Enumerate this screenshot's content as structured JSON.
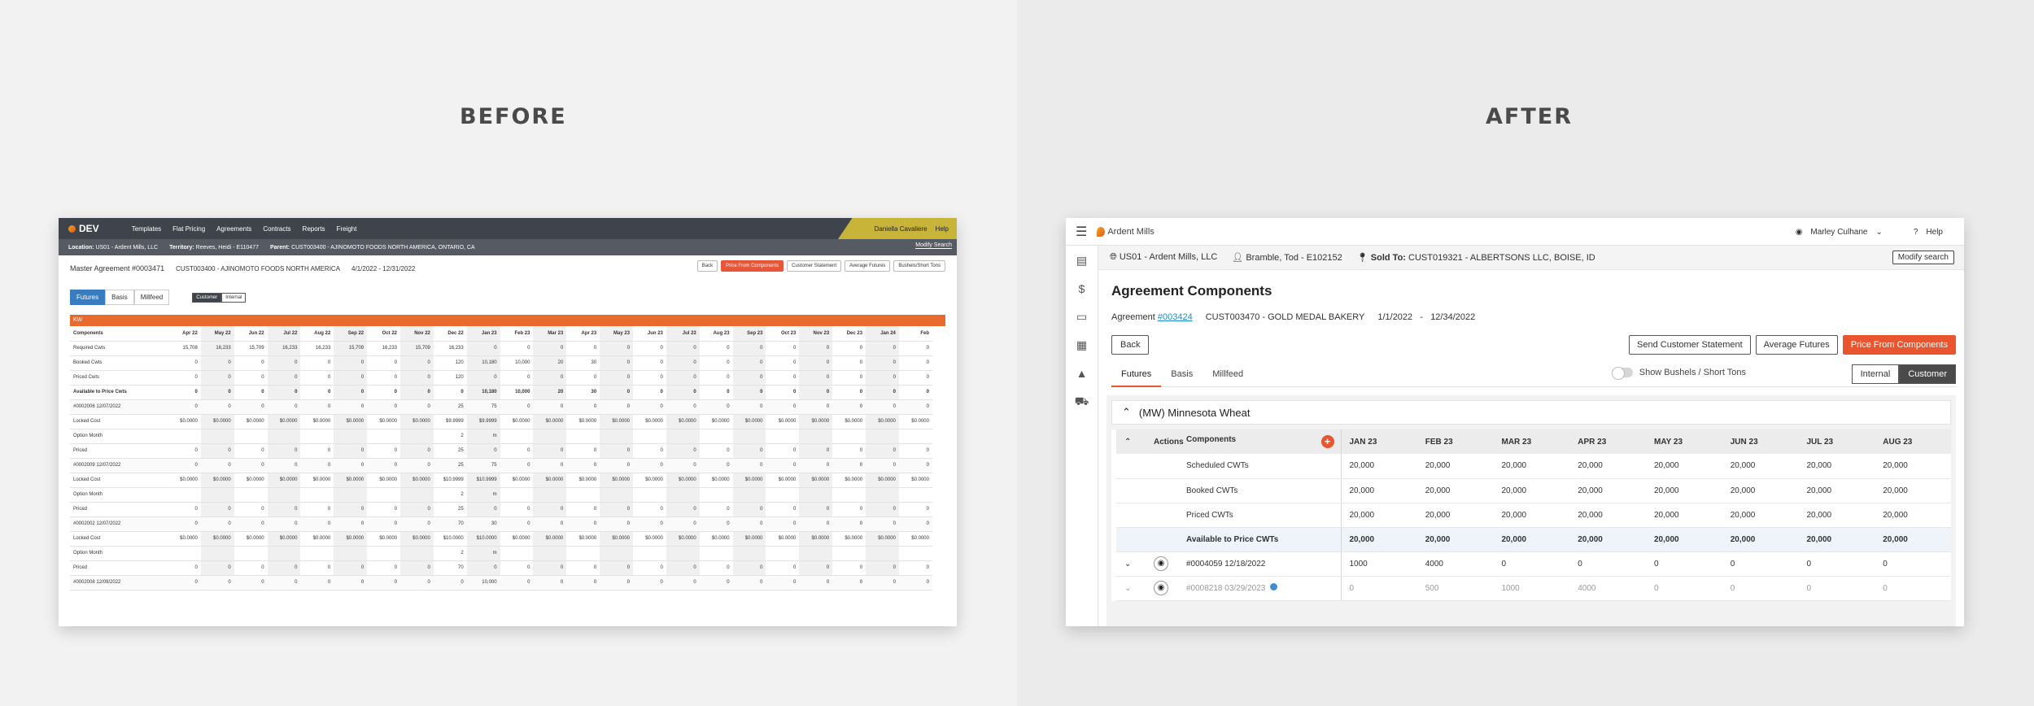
{
  "headings": {
    "before": "BEFORE",
    "after": "AFTER"
  },
  "before": {
    "logo": "DEV",
    "nav": [
      "Templates",
      "Flat Pricing",
      "Agreements",
      "Contracts",
      "Reports",
      "Freight"
    ],
    "user": "Daniella Cavaliere",
    "help": "Help",
    "location_label": "Location:",
    "location": "US01 - Ardent Mills, LLC",
    "territory_label": "Territory:",
    "territory": "Reeves, Heidi - E110477",
    "parent_label": "Parent:",
    "parent": "CUST003400 - AJINOMOTO FOODS NORTH AMERICA, ONTARIO, CA",
    "modify_search": "Modify Search",
    "title": "Master Agreement #0003471",
    "customer": "CUST003400 - AJINOMOTO FOODS NORTH AMERICA",
    "dates": "4/1/2022 - 12/31/2022",
    "buttons": [
      "Back",
      "Price From Components",
      "Customer Statement",
      "Average Futures",
      "Bushels/Short Tons"
    ],
    "tabs": [
      "Futures",
      "Basis",
      "Millfeed"
    ],
    "view_toggle": [
      "Customer",
      "Internal"
    ],
    "section": "KW",
    "components_label": "Components",
    "months": [
      "Apr 22",
      "May 22",
      "Jun 22",
      "Jul 22",
      "Aug 22",
      "Sep 22",
      "Oct 22",
      "Nov 22",
      "Dec 22",
      "Jan 23",
      "Feb 23",
      "Mar 23",
      "Apr 23",
      "May 23",
      "Jun 23",
      "Jul 23",
      "Aug 23",
      "Sep 23",
      "Oct 23",
      "Nov 23",
      "Dec 23",
      "Jan 24",
      "Feb"
    ],
    "rows": [
      {
        "label": "Required Cwts",
        "values": [
          "15,708",
          "16,233",
          "15,709",
          "16,233",
          "16,233",
          "15,709",
          "16,233",
          "15,709",
          "16,233",
          "0",
          "0",
          "0",
          "0",
          "0",
          "0",
          "0",
          "0",
          "0",
          "0",
          "0",
          "0",
          "0",
          "0"
        ]
      },
      {
        "label": "Booked Cwts",
        "values": [
          "0",
          "0",
          "0",
          "0",
          "0",
          "0",
          "0",
          "0",
          "120",
          "10,180",
          "10,000",
          "20",
          "30",
          "0",
          "0",
          "0",
          "0",
          "0",
          "0",
          "0",
          "0",
          "0",
          "0"
        ]
      },
      {
        "label": "Priced Cwts",
        "values": [
          "0",
          "0",
          "0",
          "0",
          "0",
          "0",
          "0",
          "0",
          "120",
          "0",
          "0",
          "0",
          "0",
          "0",
          "0",
          "0",
          "0",
          "0",
          "0",
          "0",
          "0",
          "0",
          "0"
        ]
      },
      {
        "label": "Available to Price Cwts",
        "bold": true,
        "values": [
          "0",
          "0",
          "0",
          "0",
          "0",
          "0",
          "0",
          "0",
          "0",
          "10,180",
          "10,000",
          "20",
          "30",
          "0",
          "0",
          "0",
          "0",
          "0",
          "0",
          "0",
          "0",
          "0",
          "0"
        ]
      },
      {
        "label": "#0002006 12/07/2022",
        "group": true,
        "values": [
          "0",
          "0",
          "0",
          "0",
          "0",
          "0",
          "0",
          "0",
          "25",
          "75",
          "0",
          "0",
          "0",
          "0",
          "0",
          "0",
          "0",
          "0",
          "0",
          "0",
          "0",
          "0",
          "0"
        ]
      },
      {
        "label": "Locked Cost",
        "values": [
          "$0.0000",
          "$0.0000",
          "$0.0000",
          "$0.0000",
          "$0.0000",
          "$0.0000",
          "$0.0000",
          "$0.0000",
          "$9.9999",
          "$9.9999",
          "$0.0000",
          "$0.0000",
          "$0.0000",
          "$0.0000",
          "$0.0000",
          "$0.0000",
          "$0.0000",
          "$0.0000",
          "$0.0000",
          "$0.0000",
          "$0.0000",
          "$0.0000",
          "$0.0000"
        ]
      },
      {
        "label": "Option Month",
        "values": [
          "",
          "",
          "",
          "",
          "",
          "",
          "",
          "",
          "2",
          "m",
          "",
          "",
          "",
          "",
          "",
          "",
          "",
          "",
          "",
          "",
          "",
          "",
          ""
        ]
      },
      {
        "label": "Priced",
        "values": [
          "0",
          "0",
          "0",
          "0",
          "0",
          "0",
          "0",
          "0",
          "25",
          "0",
          "0",
          "0",
          "0",
          "0",
          "0",
          "0",
          "0",
          "0",
          "0",
          "0",
          "0",
          "0",
          "0"
        ]
      },
      {
        "label": "#0002009 12/07/2022",
        "group": true,
        "values": [
          "0",
          "0",
          "0",
          "0",
          "0",
          "0",
          "0",
          "0",
          "25",
          "75",
          "0",
          "0",
          "0",
          "0",
          "0",
          "0",
          "0",
          "0",
          "0",
          "0",
          "0",
          "0",
          "0"
        ]
      },
      {
        "label": "Locked Cost",
        "values": [
          "$0.0000",
          "$0.0000",
          "$0.0000",
          "$0.0000",
          "$0.0000",
          "$0.0000",
          "$0.0000",
          "$0.0000",
          "$10.9999",
          "$10.9999",
          "$0.0000",
          "$0.0000",
          "$0.0000",
          "$0.0000",
          "$0.0000",
          "$0.0000",
          "$0.0000",
          "$0.0000",
          "$0.0000",
          "$0.0000",
          "$0.0000",
          "$0.0000",
          "$0.0000"
        ]
      },
      {
        "label": "Option Month",
        "values": [
          "",
          "",
          "",
          "",
          "",
          "",
          "",
          "",
          "2",
          "m",
          "",
          "",
          "",
          "",
          "",
          "",
          "",
          "",
          "",
          "",
          "",
          "",
          ""
        ]
      },
      {
        "label": "Priced",
        "values": [
          "0",
          "0",
          "0",
          "0",
          "0",
          "0",
          "0",
          "0",
          "25",
          "0",
          "0",
          "0",
          "0",
          "0",
          "0",
          "0",
          "0",
          "0",
          "0",
          "0",
          "0",
          "0",
          "0"
        ]
      },
      {
        "label": "#0002002 12/07/2022",
        "group": true,
        "values": [
          "0",
          "0",
          "0",
          "0",
          "0",
          "0",
          "0",
          "0",
          "70",
          "30",
          "0",
          "0",
          "0",
          "0",
          "0",
          "0",
          "0",
          "0",
          "0",
          "0",
          "0",
          "0",
          "0"
        ]
      },
      {
        "label": "Locked Cost",
        "values": [
          "$0.0000",
          "$0.0000",
          "$0.0000",
          "$0.0000",
          "$0.0000",
          "$0.0000",
          "$0.0000",
          "$0.0000",
          "$10.0000",
          "$10.0000",
          "$0.0000",
          "$0.0000",
          "$0.0000",
          "$0.0000",
          "$0.0000",
          "$0.0000",
          "$0.0000",
          "$0.0000",
          "$0.0000",
          "$0.0000",
          "$0.0000",
          "$0.0000",
          "$0.0000"
        ]
      },
      {
        "label": "Option Month",
        "values": [
          "",
          "",
          "",
          "",
          "",
          "",
          "",
          "",
          "2",
          "m",
          "",
          "",
          "",
          "",
          "",
          "",
          "",
          "",
          "",
          "",
          "",
          "",
          ""
        ]
      },
      {
        "label": "Priced",
        "values": [
          "0",
          "0",
          "0",
          "0",
          "0",
          "0",
          "0",
          "0",
          "70",
          "0",
          "0",
          "0",
          "0",
          "0",
          "0",
          "0",
          "0",
          "0",
          "0",
          "0",
          "0",
          "0",
          "0"
        ]
      },
      {
        "label": "#0002008 12/09/2022",
        "group": true,
        "values": [
          "0",
          "0",
          "0",
          "0",
          "0",
          "0",
          "0",
          "0",
          "0",
          "10,000",
          "0",
          "0",
          "0",
          "0",
          "0",
          "0",
          "0",
          "0",
          "0",
          "0",
          "0",
          "0",
          "0"
        ]
      }
    ]
  },
  "after": {
    "brand": "Ardent Mills",
    "user": "Marley Culhane",
    "help": "Help",
    "location": "US01 - Ardent Mills, LLC",
    "territory": "Bramble, Tod - E102152",
    "sold_to_label": "Sold To:",
    "sold_to": "CUST019321 - ALBERTSONS LLC, BOISE, ID",
    "modify_search": "Modify search",
    "title": "Agreement Components",
    "agreement_label": "Agreement",
    "agreement_link": "#003424",
    "customer": "CUST003470 - GOLD MEDAL BAKERY",
    "date_from": "1/1/2022",
    "date_sep": "-",
    "date_to": "12/34/2022",
    "back": "Back",
    "actions": [
      "Send Customer Statement",
      "Average Futures",
      "Price From Components"
    ],
    "tabs": [
      "Futures",
      "Basis",
      "Millfeed"
    ],
    "toggle_label": "Show Bushels / Short Tons",
    "view_toggle": [
      "Internal",
      "Customer"
    ],
    "section": "(MW) Minnesota Wheat",
    "col_actions": "Actions",
    "col_components": "Components",
    "months": [
      "JAN 23",
      "FEB 23",
      "MAR 23",
      "APR 23",
      "MAY 23",
      "JUN 23",
      "JUL 23",
      "AUG 23"
    ],
    "rows": [
      {
        "label": "Scheduled CWTs",
        "values": [
          "20,000",
          "20,000",
          "20,000",
          "20,000",
          "20,000",
          "20,000",
          "20,000",
          "20,000"
        ]
      },
      {
        "label": "Booked CWTs",
        "values": [
          "20,000",
          "20,000",
          "20,000",
          "20,000",
          "20,000",
          "20,000",
          "20,000",
          "20,000"
        ]
      },
      {
        "label": "Priced CWTs",
        "values": [
          "20,000",
          "20,000",
          "20,000",
          "20,000",
          "20,000",
          "20,000",
          "20,000",
          "20,000"
        ]
      },
      {
        "label": "Available to Price CWTs",
        "avail": true,
        "values": [
          "20,000",
          "20,000",
          "20,000",
          "20,000",
          "20,000",
          "20,000",
          "20,000",
          "20,000"
        ]
      },
      {
        "label": "#0004059  12/18/2022",
        "expand": true,
        "values": [
          "1000",
          "4000",
          "0",
          "0",
          "0",
          "0",
          "0",
          "0"
        ]
      },
      {
        "label": "#0008218  03/29/2023",
        "expand": true,
        "dim": true,
        "info": true,
        "values": [
          "0",
          "500",
          "1000",
          "4000",
          "0",
          "0",
          "0",
          "0"
        ]
      }
    ]
  }
}
